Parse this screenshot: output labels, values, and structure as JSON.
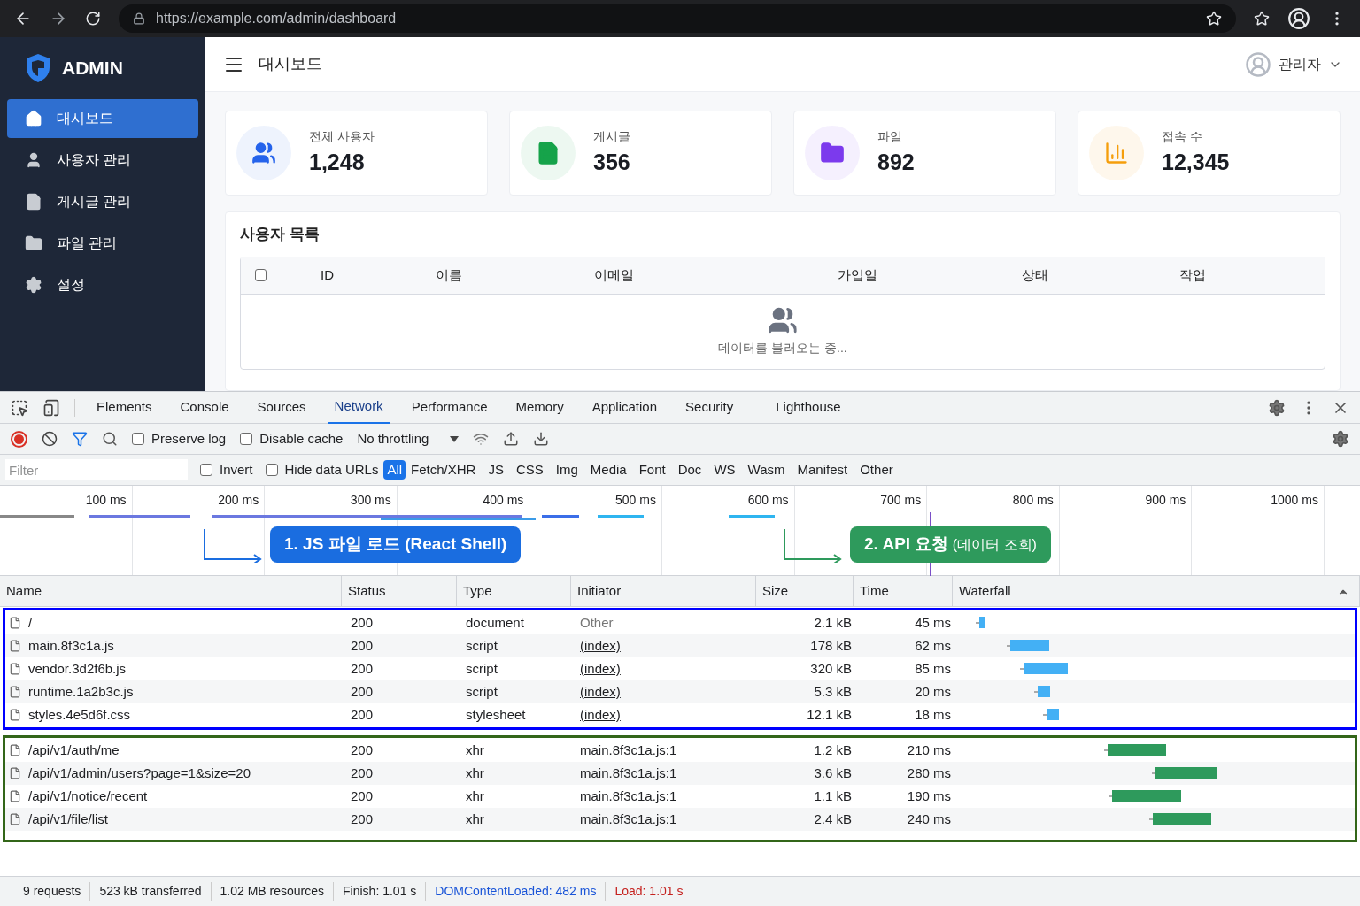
{
  "browser": {
    "url": "https://example.com/admin/dashboard"
  },
  "sidebar": {
    "brand": "ADMIN",
    "items": [
      {
        "label": "대시보드",
        "kind": "home",
        "selected": true
      },
      {
        "label": "사용자 관리",
        "kind": "user",
        "selected": false
      },
      {
        "label": "게시글 관리",
        "kind": "doc",
        "selected": false
      },
      {
        "label": "파일 관리",
        "kind": "folder",
        "selected": false
      },
      {
        "label": "설정",
        "kind": "gear",
        "selected": false
      }
    ]
  },
  "header": {
    "title": "대시보드",
    "user": "관리자"
  },
  "stats": [
    {
      "label": "전체 사용자",
      "value": "1,248",
      "kind": "users",
      "color": "#2563eb"
    },
    {
      "label": "게시글",
      "value": "356",
      "kind": "doc",
      "color": "#16a34a"
    },
    {
      "label": "파일",
      "value": "892",
      "kind": "folder",
      "color": "#7c3aed"
    },
    {
      "label": "접속 수",
      "value": "12,345",
      "kind": "chart",
      "color": "#f59e0b"
    }
  ],
  "user_list": {
    "title": "사용자 목록",
    "select_all_checked": false,
    "columns": [
      "ID",
      "이름",
      "이메일",
      "가입일",
      "상태",
      "작업"
    ],
    "loading": "데이터를 불러오는 중..."
  },
  "devtools": {
    "tabs": [
      {
        "label": "Elements",
        "selected": false
      },
      {
        "label": "Console",
        "selected": false
      },
      {
        "label": "Sources",
        "selected": false
      },
      {
        "label": "Network",
        "selected": true
      },
      {
        "label": "Performance",
        "selected": false
      },
      {
        "label": "Memory",
        "selected": false
      },
      {
        "label": "Application",
        "selected": false
      },
      {
        "label": "Security",
        "selected": false
      },
      {
        "label": "Lighthouse",
        "selected": false
      }
    ],
    "preserve_log": {
      "label": "Preserve log",
      "checked": false
    },
    "disable_cache": {
      "label": "Disable cache",
      "checked": false
    },
    "throttling": "No throttling",
    "filter_placeholder": "Filter",
    "invert": {
      "label": "Invert",
      "checked": false
    },
    "hide_data_urls": {
      "label": "Hide data URLs",
      "checked": false
    },
    "types": [
      {
        "label": "All",
        "selected": true
      },
      {
        "label": "Fetch/XHR",
        "selected": false
      },
      {
        "label": "JS",
        "selected": false
      },
      {
        "label": "CSS",
        "selected": false
      },
      {
        "label": "Img",
        "selected": false
      },
      {
        "label": "Media",
        "selected": false
      },
      {
        "label": "Font",
        "selected": false
      },
      {
        "label": "Doc",
        "selected": false
      },
      {
        "label": "WS",
        "selected": false
      },
      {
        "label": "Wasm",
        "selected": false
      },
      {
        "label": "Manifest",
        "selected": false
      },
      {
        "label": "Other",
        "selected": false
      }
    ],
    "ticks": [
      "100 ms",
      "200 ms",
      "300 ms",
      "400 ms",
      "500 ms",
      "600 ms",
      "700 ms",
      "800 ms",
      "900 ms",
      "1000 ms"
    ],
    "annotations": [
      {
        "label": "1. JS 파일 로드 (React Shell)",
        "color": "#1a6de0"
      },
      {
        "label": "2. API 요청",
        "note": "(데이터 조회)",
        "color": "#2e9a5c"
      }
    ],
    "columns": [
      "Name",
      "Status",
      "Type",
      "Initiator",
      "Size",
      "Time",
      "Waterfall"
    ],
    "groups": [
      {
        "color": "#0000ff",
        "rows": [
          {
            "name": "/",
            "status": "200",
            "type": "document",
            "initiator": "Other",
            "link": false,
            "size": "2.1 kB",
            "time": "45 ms"
          },
          {
            "name": "main.8f3c1a.js",
            "status": "200",
            "type": "script",
            "initiator": "(index)",
            "link": true,
            "size": "178 kB",
            "time": "62 ms"
          },
          {
            "name": "vendor.3d2f6b.js",
            "status": "200",
            "type": "script",
            "initiator": "(index)",
            "link": true,
            "size": "320 kB",
            "time": "85 ms"
          },
          {
            "name": "runtime.1a2b3c.js",
            "status": "200",
            "type": "script",
            "initiator": "(index)",
            "link": true,
            "size": "5.3 kB",
            "time": "20 ms"
          },
          {
            "name": "styles.4e5d6f.css",
            "status": "200",
            "type": "stylesheet",
            "initiator": "(index)",
            "link": true,
            "size": "12.1 kB",
            "time": "18 ms"
          }
        ]
      },
      {
        "color": "#336619",
        "rows": [
          {
            "name": "/api/v1/auth/me",
            "status": "200",
            "type": "xhr",
            "initiator": "main.8f3c1a.js:1",
            "link": true,
            "size": "1.2 kB",
            "time": "210 ms"
          },
          {
            "name": "/api/v1/admin/users?page=1&size=20",
            "status": "200",
            "type": "xhr",
            "initiator": "main.8f3c1a.js:1",
            "link": true,
            "size": "3.6 kB",
            "time": "280 ms"
          },
          {
            "name": "/api/v1/notice/recent",
            "status": "200",
            "type": "xhr",
            "initiator": "main.8f3c1a.js:1",
            "link": true,
            "size": "1.1 kB",
            "time": "190 ms"
          },
          {
            "name": "/api/v1/file/list",
            "status": "200",
            "type": "xhr",
            "initiator": "main.8f3c1a.js:1",
            "link": true,
            "size": "2.4 kB",
            "time": "240 ms"
          }
        ]
      }
    ],
    "status_bar": [
      {
        "text": "9 requests",
        "kind": "plain"
      },
      {
        "text": "523 kB transferred",
        "kind": "plain"
      },
      {
        "text": "1.02 MB resources",
        "kind": "plain"
      },
      {
        "text": "Finish: 1.01 s",
        "kind": "plain"
      },
      {
        "text": "DOMContentLoaded: 482 ms",
        "kind": "dcl"
      },
      {
        "text": "Load: 1.01 s",
        "kind": "load"
      }
    ]
  }
}
